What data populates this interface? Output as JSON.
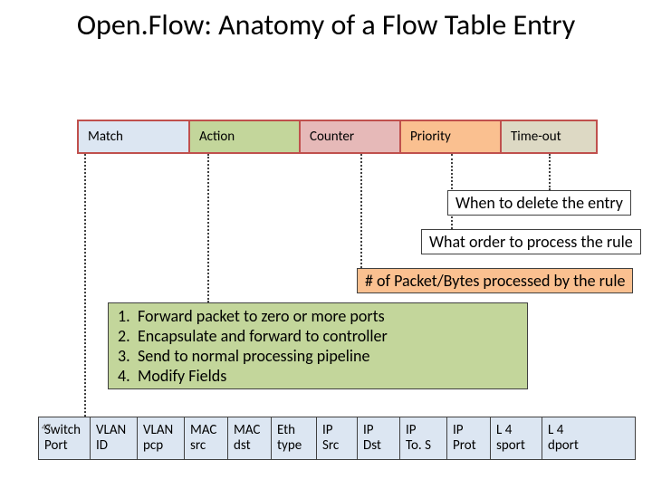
{
  "title": "Open.Flow: Anatomy of a Flow Table Entry",
  "fields": {
    "match": "Match",
    "action": "Action",
    "counter": "Counter",
    "priority": "Priority",
    "timeout": "Time-out"
  },
  "callouts": {
    "timeout": "When to delete the entry",
    "priority": "What order to process the rule",
    "counter": "# of Packet/Bytes processed by the rule"
  },
  "actions": {
    "n1": "1.",
    "t1": "Forward packet to zero or more ports",
    "n2": "2.",
    "t2": "Encapsulate and forward to controller",
    "n3": "3.",
    "t3": "Send to normal processing pipeline",
    "n4": "4.",
    "t4": "Modify Fields"
  },
  "matchfields": {
    "switch_a": "Switch",
    "switch_b": "Port",
    "vlanid_a": "VLAN",
    "vlanid_b": "ID",
    "vlanpcp_a": "VLAN",
    "vlanpcp_b": "pcp",
    "macsrc_a": "MAC",
    "macsrc_b": "src",
    "macdst_a": "MAC",
    "macdst_b": "dst",
    "ethtype_a": "Eth",
    "ethtype_b": "type",
    "ipsrc_a": "IP",
    "ipsrc_b": "Src",
    "ipdst_a": "IP",
    "ipdst_b": "Dst",
    "iptos_a": "IP",
    "iptos_b": "To. S",
    "ipprot_a": "IP",
    "ipprot_b": "Prot",
    "sport_a": "L 4",
    "sport_b": "sport",
    "dport_a": "L 4",
    "dport_b": "dport"
  },
  "page_number": "47"
}
